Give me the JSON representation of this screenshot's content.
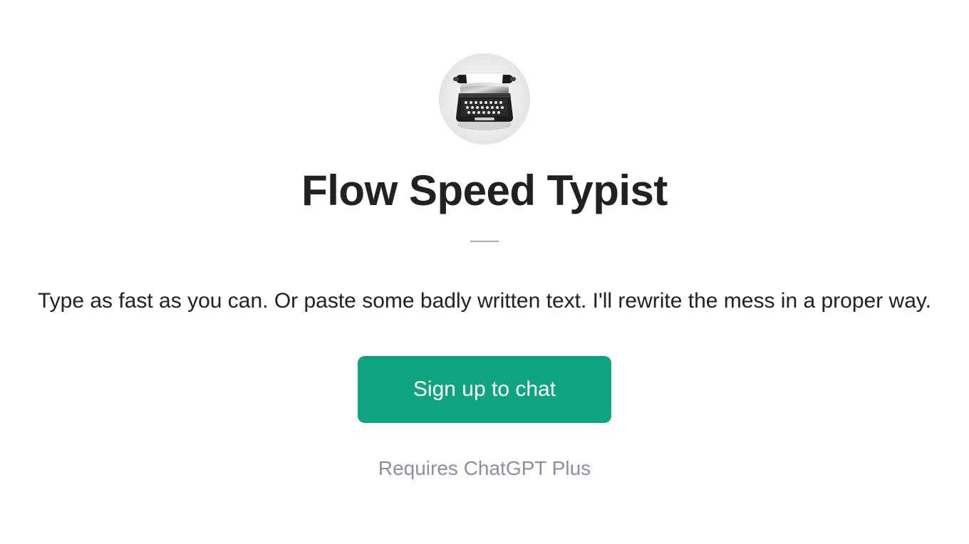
{
  "app": {
    "title": "Flow Speed Typist",
    "description": "Type as fast as you can. Or paste some badly written text. I'll rewrite the mess in a proper way.",
    "signup_label": "Sign up to chat",
    "requirement": "Requires ChatGPT Plus",
    "icon_name": "typewriter-icon"
  }
}
